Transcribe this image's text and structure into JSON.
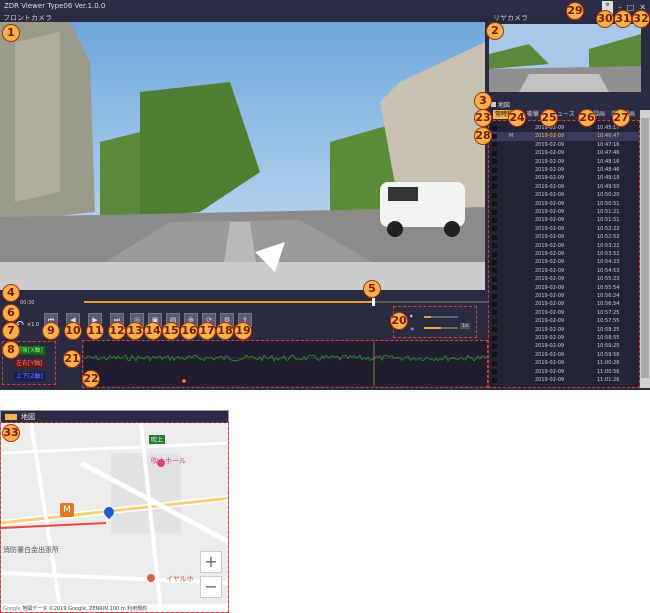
{
  "app": {
    "title": "ZDR Viewer Type06 Ver.1.0.0",
    "front_label": "フロントカメラ",
    "rear_label": "リヤカメラ",
    "map_label": "地図",
    "time_current": "00:30",
    "speed_label": "×1.0",
    "sens_label": "1x",
    "ref_label": "リファレンス"
  },
  "indicators": {
    "front_back": "前後[X軸]",
    "left_right": "左右[Y軸]",
    "up_down": "上下[Z軸]"
  },
  "list_tabs": [
    "常時録画",
    "衝撃",
    "ニュース",
    "駐車録画",
    "手動録画"
  ],
  "list_rows": [
    {
      "mark": "",
      "date": "2019-02-09",
      "time": "10:45:17"
    },
    {
      "mark": "M",
      "date": "2019-02-09",
      "time": "10:46:47"
    },
    {
      "mark": "",
      "date": "2019-02-09",
      "time": "10:47:16"
    },
    {
      "mark": "",
      "date": "2019-02-09",
      "time": "10:47:46"
    },
    {
      "mark": "",
      "date": "2019-02-09",
      "time": "10:48:16"
    },
    {
      "mark": "",
      "date": "2019-02-09",
      "time": "10:48:46"
    },
    {
      "mark": "",
      "date": "2019-02-09",
      "time": "10:49:19"
    },
    {
      "mark": "",
      "date": "2019-02-09",
      "time": "10:49:50"
    },
    {
      "mark": "",
      "date": "2019-02-09",
      "time": "10:50:20"
    },
    {
      "mark": "",
      "date": "2019-02-09",
      "time": "10:50:51"
    },
    {
      "mark": "",
      "date": "2019-02-09",
      "time": "10:51:21"
    },
    {
      "mark": "",
      "date": "2019-02-09",
      "time": "10:51:51"
    },
    {
      "mark": "",
      "date": "2019-02-09",
      "time": "10:52:22"
    },
    {
      "mark": "",
      "date": "2019-02-09",
      "time": "10:52:52"
    },
    {
      "mark": "",
      "date": "2019-02-09",
      "time": "10:53:22"
    },
    {
      "mark": "",
      "date": "2019-02-09",
      "time": "10:53:52"
    },
    {
      "mark": "",
      "date": "2019-02-09",
      "time": "10:54:23"
    },
    {
      "mark": "",
      "date": "2019-02-09",
      "time": "10:54:53"
    },
    {
      "mark": "",
      "date": "2019-02-09",
      "time": "10:55:23"
    },
    {
      "mark": "",
      "date": "2019-02-09",
      "time": "10:55:54"
    },
    {
      "mark": "",
      "date": "2019-02-09",
      "time": "10:56:24"
    },
    {
      "mark": "",
      "date": "2019-02-09",
      "time": "10:56:54"
    },
    {
      "mark": "",
      "date": "2019-02-09",
      "time": "10:57:25"
    },
    {
      "mark": "",
      "date": "2019-02-09",
      "time": "10:57:55"
    },
    {
      "mark": "",
      "date": "2019-02-09",
      "time": "10:58:25"
    },
    {
      "mark": "",
      "date": "2019-02-09",
      "time": "10:58:55"
    },
    {
      "mark": "",
      "date": "2019-02-09",
      "time": "10:59:25"
    },
    {
      "mark": "",
      "date": "2019-02-09",
      "time": "10:59:56"
    },
    {
      "mark": "",
      "date": "2019-02-09",
      "time": "11:00:26"
    },
    {
      "mark": "",
      "date": "2019-02-09",
      "time": "11:00:56"
    },
    {
      "mark": "",
      "date": "2019-02-09",
      "time": "11:01:26"
    }
  ],
  "markers": [
    "1",
    "2",
    "3",
    "4",
    "5",
    "6",
    "7",
    "8",
    "9",
    "10",
    "11",
    "12",
    "13",
    "14",
    "15",
    "16",
    "17",
    "18",
    "19",
    "20",
    "21",
    "22",
    "23",
    "24",
    "25",
    "26",
    "27",
    "28",
    "29",
    "30",
    "31",
    "32",
    "33"
  ],
  "map": {
    "place_1": "吹上ホール",
    "place_2": "吹上",
    "place_3": "イヤルホ",
    "place_4": "消防署白金出張所",
    "attribution": "地図データ ©2019 Google, ZENRIN",
    "scale": "100 m",
    "terms": "利用規約",
    "google": "Google"
  },
  "colors": {
    "accent": "#f6b24a",
    "annotation": "#e03a2a",
    "wave": "#3fae3f"
  }
}
